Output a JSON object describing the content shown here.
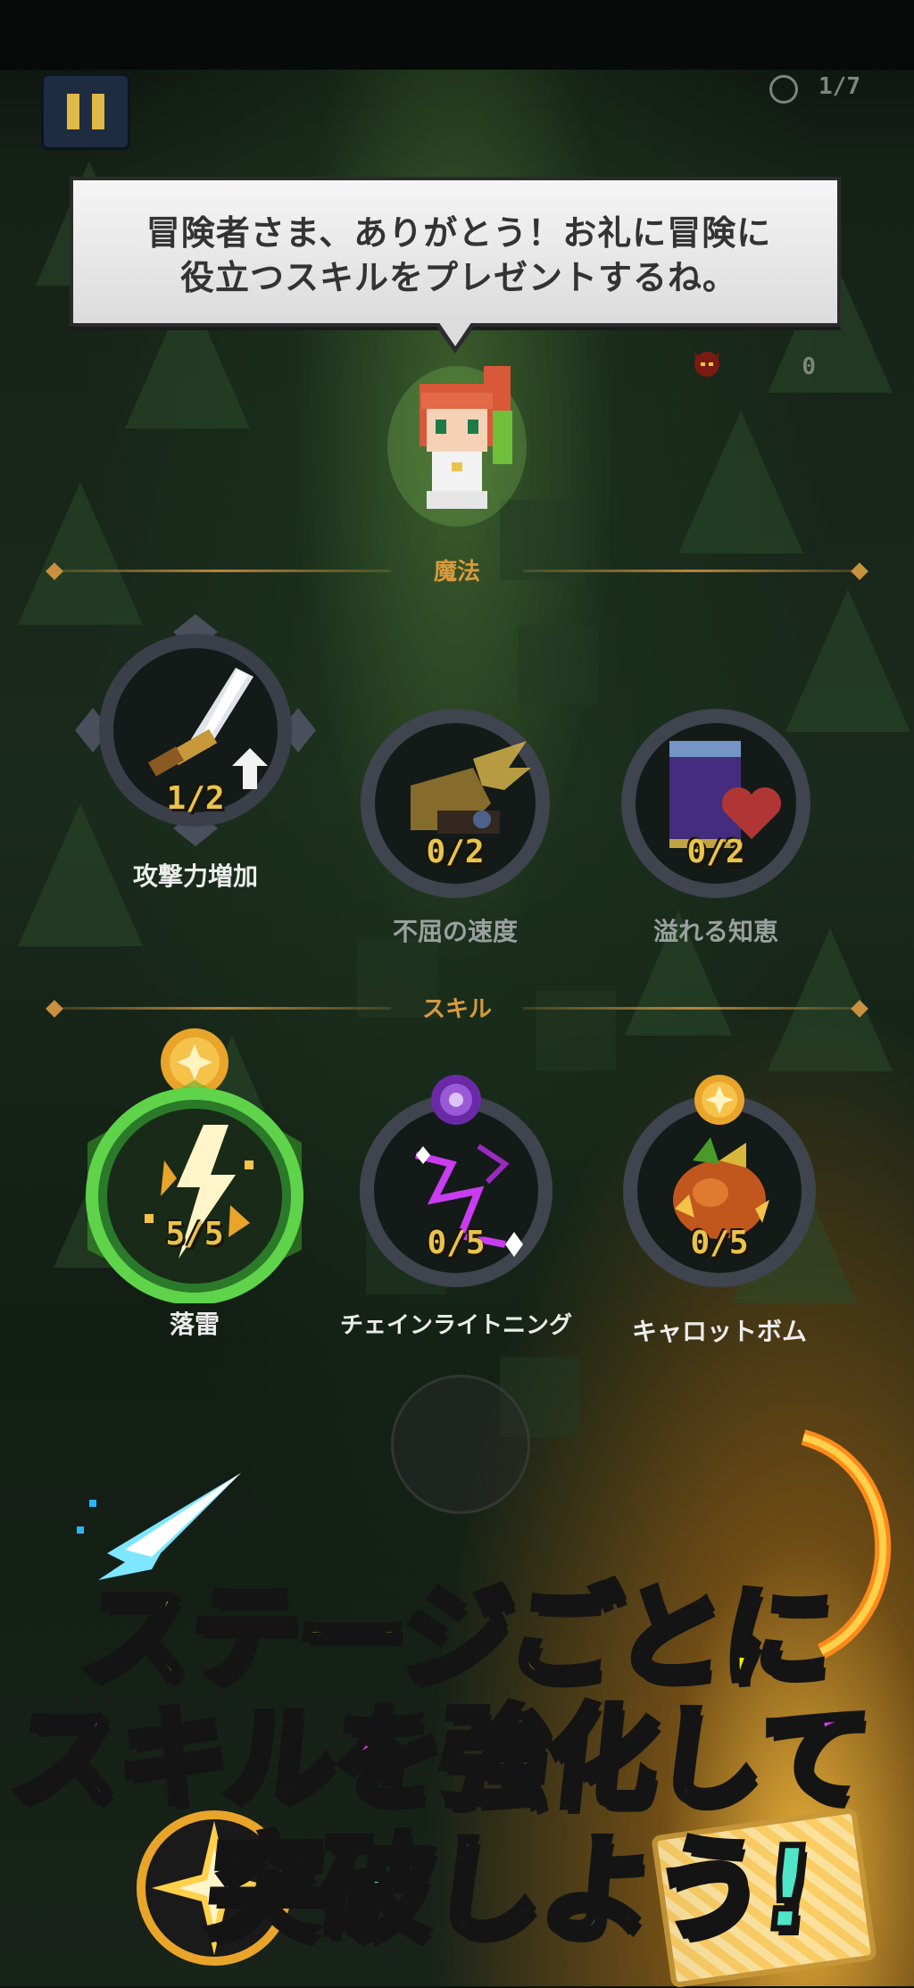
{
  "hud": {
    "stage_counter": "1/7",
    "side_counter": "0"
  },
  "dialog": {
    "line1": "冒険者さま、ありがとう！お礼に冒険に",
    "line2": "役立つスキルをプレゼントするね。"
  },
  "sections": {
    "magic_label": "魔法",
    "skill_label": "スキル"
  },
  "magic_skills": [
    {
      "name": "攻撃力増加",
      "count": "1/2",
      "icon": "sword-upgrade-icon"
    },
    {
      "name": "不屈の速度",
      "count": "0/2",
      "icon": "winged-boot-icon"
    },
    {
      "name": "溢れる知恵",
      "count": "0/2",
      "icon": "spellbook-heart-icon"
    }
  ],
  "active_skills": [
    {
      "name": "落雷",
      "count": "5/5",
      "icon": "lightning-icon"
    },
    {
      "name": "チェインライトニング",
      "count": "0/5",
      "icon": "chain-lightning-icon"
    },
    {
      "name": "キャロットボム",
      "count": "0/5",
      "icon": "carrot-bomb-icon"
    }
  ],
  "promo": {
    "line1": "ステージごとに",
    "line2": "スキルを強化して",
    "line3": "突破しよう!"
  },
  "colors": {
    "gold": "#e8c44c",
    "section_gold": "#d79a3c",
    "ring_green": "#5fd34a",
    "ring_gray": "#4a4f57",
    "promo_yellow": "#fff200",
    "promo_purple": "#d63cf0",
    "promo_teal": "#4fe6c8"
  }
}
